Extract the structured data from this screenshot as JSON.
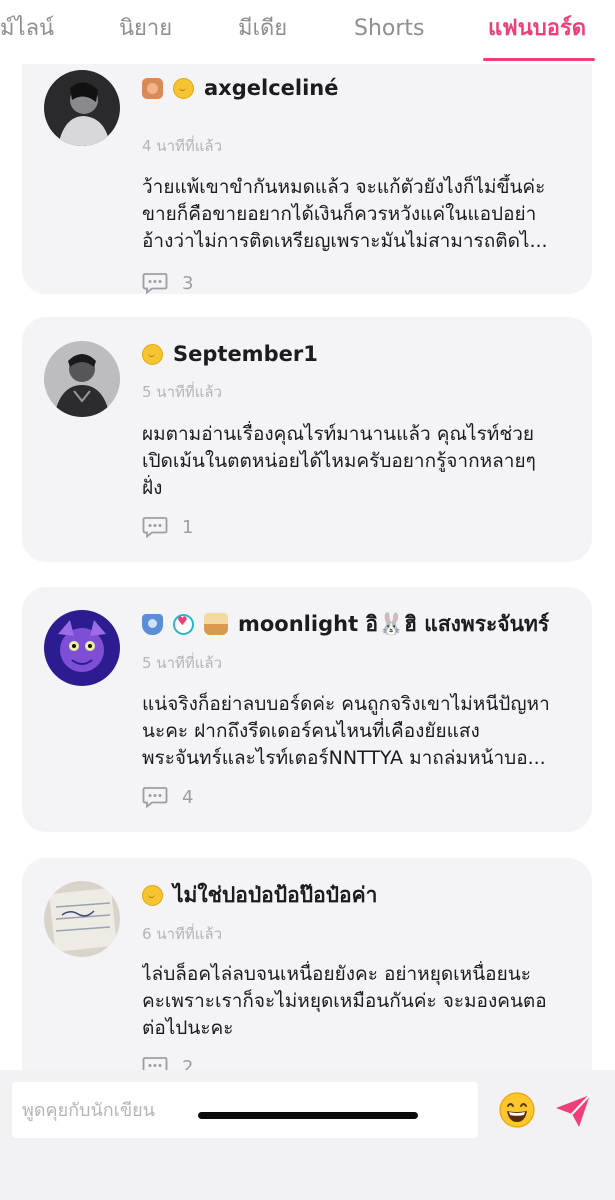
{
  "tabs": [
    {
      "label": "ม์ไลน์",
      "active": false
    },
    {
      "label": "นิยาย",
      "active": false
    },
    {
      "label": "มีเดีย",
      "active": false
    },
    {
      "label": "Shorts",
      "active": false
    },
    {
      "label": "แฟนบอร์ด",
      "active": true
    }
  ],
  "accent_color": "#ef3f7a",
  "comments": [
    {
      "username": "axgelceliné",
      "badges": [
        "bronze-medal-icon",
        "gold-coin-icon"
      ],
      "time": "4 นาทีที่แล้ว",
      "lines": [
        "ว้ายแพ้เขาขำกันหมดแล้ว จะแก้ตัวยังไงก็ไม่ขึ้นค่ะ",
        "ขายก็คือขายอยากได้เงินก็ควรหวังแค่ในแอปอย่า",
        "อ้างว่าไม่การติดเหรียญเพราะมันไม่สามารถติดไ..."
      ],
      "reply_count": "3"
    },
    {
      "username": "September1",
      "badges": [
        "gold-coin-icon"
      ],
      "time": "5 นาทีที่แล้ว",
      "lines": [
        "ผมตามอ่านเรื่องคุณไรท์มานานแล้ว คุณไรท์ช่วย",
        "เปิดเม้นในตตหน่อยได้ไหมครับอยากรู้จากหลายๆ",
        "ฝั่ง"
      ],
      "reply_count": "1"
    },
    {
      "username": "moonlight อิ🐰ฮิ  แสงพระจันทร์",
      "badges": [
        "shield-badge-icon",
        "heart-badge-icon",
        "cupcake-badge-icon"
      ],
      "time": "5 นาทีที่แล้ว",
      "lines": [
        "แน่จริงก็อย่าลบบอร์ดค่ะ คนถูกจริงเขาไม่หนีปัญหา",
        "นะคะ ฝากถึงรีดเดอร์คนไหนที่เคืองยัยแสง",
        "พระจันทร์และไรท์เตอร์NNTTYA มาถล่มหน้าบอ..."
      ],
      "reply_count": "4"
    },
    {
      "username": "ไม่ใช่ปอป่อป้อป๊อป๋อค่า",
      "badges": [
        "gold-coin-icon"
      ],
      "time": "6 นาทีที่แล้ว",
      "lines": [
        "ไล่บล็อคไล่ลบจนเหนื่อยยังคะ อย่าหยุดเหนื่อยนะ",
        "คะเพราะเราก็จะไม่หยุดเหมือนกันค่ะ จะมองคนตอ",
        "ต่อไปนะคะ"
      ],
      "reply_count": "2"
    }
  ],
  "chat": {
    "placeholder": "พูดคุยกับนักเขียน",
    "emoji_icon": "grinning-face-icon",
    "send_icon": "paper-plane-send-icon"
  }
}
